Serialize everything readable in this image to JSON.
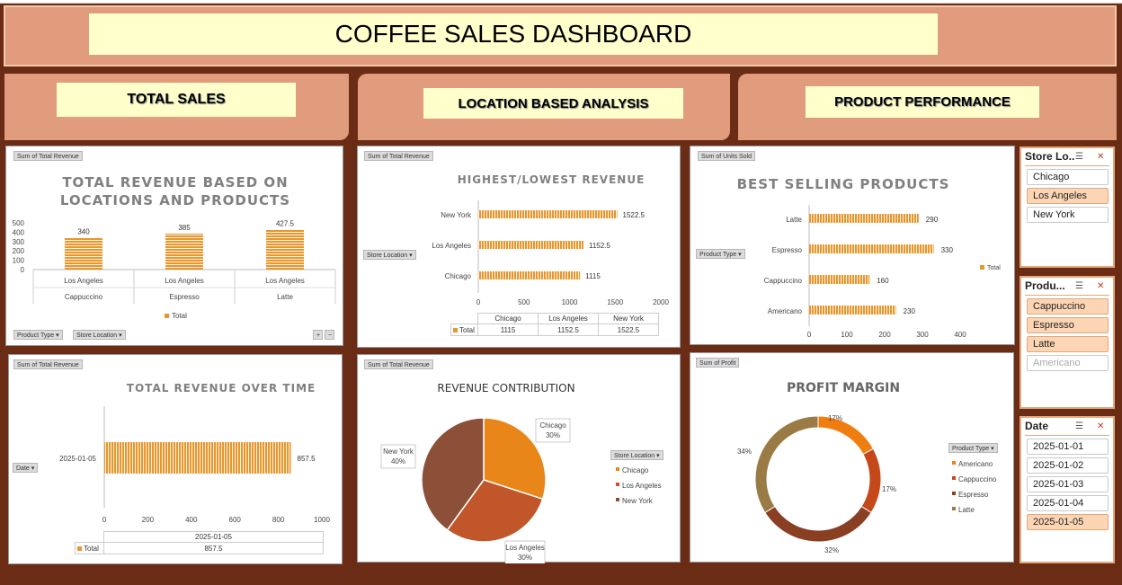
{
  "title": "COFFEE SALES DASHBOARD",
  "sections": {
    "total_sales": "TOTAL SALES",
    "location": "LOCATION BASED ANALYSIS",
    "product": "PRODUCT PERFORMANCE"
  },
  "colors": {
    "bar": "#e8962e",
    "dark_brown": "#6a2c14",
    "salmon": "#e09c7c",
    "label_yellow": "#ffffcc",
    "slicer_selected": "#fcd5b4"
  },
  "chart1": {
    "field": "Sum of Total Revenue",
    "title_line1": "TOTAL REVENUE  BASED ON",
    "title_line2": "LOCATIONS AND PRODUCTS",
    "filter1": "Product Type",
    "filter2": "Store Location",
    "legend": "Total",
    "yticks": [
      "500",
      "400",
      "300",
      "200",
      "100",
      "0"
    ]
  },
  "chart2": {
    "field": "Sum of Total Revenue",
    "title": "HIGHEST/LOWEST REVENUE",
    "filter": "Store Location",
    "xticks": [
      "0",
      "500",
      "1000",
      "1500",
      "2000"
    ],
    "table_total": "Total"
  },
  "chart3": {
    "field": "Sum of Units Sold",
    "title": "BEST SELLING PRODUCTS",
    "filter": "Product Type",
    "xticks": [
      "0",
      "100",
      "200",
      "300",
      "400"
    ],
    "legend": "Total"
  },
  "chart4": {
    "field": "Sum of Total Revenue",
    "title": "TOTAL REVENUE OVER TIME",
    "filter": "Date",
    "xticks": [
      "0",
      "200",
      "400",
      "600",
      "800",
      "1000"
    ],
    "table_total": "Total"
  },
  "chart5": {
    "field": "Sum of Total Revenue",
    "title": "REVENUE CONTRIBUTION",
    "filter": "Store Location"
  },
  "chart6": {
    "field": "Sum of Profit",
    "title": "PROFIT MARGIN",
    "filter": "Product Type"
  },
  "chart_data": [
    {
      "type": "bar",
      "title": "TOTAL REVENUE  BASED ON LOCATIONS AND PRODUCTS",
      "categories": [
        "Los Angeles / Cappuccino",
        "Los Angeles / Espresso",
        "Los Angeles / Latte"
      ],
      "outer": [
        "Cappuccino",
        "Espresso",
        "Latte"
      ],
      "inner": [
        "Los Angeles",
        "Los Angeles",
        "Los Angeles"
      ],
      "series": [
        {
          "name": "Total",
          "values": [
            340,
            385,
            427.5
          ]
        }
      ],
      "ylim": [
        0,
        500
      ]
    },
    {
      "type": "bar",
      "orientation": "horizontal",
      "title": "HIGHEST/LOWEST REVENUE",
      "categories": [
        "New York",
        "Los Angeles",
        "Chicago"
      ],
      "series": [
        {
          "name": "Total",
          "values": [
            1522.5,
            1152.5,
            1115
          ]
        }
      ],
      "xlim": [
        0,
        2000
      ],
      "table": {
        "columns": [
          "Chicago",
          "Los Angeles",
          "New York"
        ],
        "values": [
          "1115",
          "1152.5",
          "1522.5"
        ]
      }
    },
    {
      "type": "bar",
      "orientation": "horizontal",
      "title": "BEST SELLING PRODUCTS",
      "categories": [
        "Latte",
        "Espresso",
        "Cappuccino",
        "Americano"
      ],
      "series": [
        {
          "name": "Total",
          "values": [
            290,
            330,
            160,
            230
          ]
        }
      ],
      "xlim": [
        0,
        400
      ]
    },
    {
      "type": "bar",
      "orientation": "horizontal",
      "title": "TOTAL REVENUE OVER TIME",
      "categories": [
        "2025-01-05"
      ],
      "series": [
        {
          "name": "Total",
          "values": [
            857.5
          ]
        }
      ],
      "xlim": [
        0,
        1000
      ],
      "table": {
        "columns": [
          "2025-01-05"
        ],
        "values": [
          "857.5"
        ]
      }
    },
    {
      "type": "pie",
      "title": "REVENUE CONTRIBUTION",
      "categories": [
        "Chicago",
        "Los Angeles",
        "New York"
      ],
      "values": [
        30,
        30,
        40
      ],
      "labels": [
        "30%",
        "30%",
        "40%"
      ],
      "colors": [
        "#e8861a",
        "#c0562a",
        "#8b5037"
      ]
    },
    {
      "type": "pie",
      "donut": true,
      "title": "PROFIT MARGIN",
      "categories": [
        "Americano",
        "Cappuccino",
        "Espresso",
        "Latte"
      ],
      "values": [
        17,
        17,
        32,
        34
      ],
      "labels": [
        "17%",
        "17%",
        "32%",
        "34%"
      ],
      "colors": [
        "#f07d10",
        "#c4481a",
        "#8a3e22",
        "#9a7b45"
      ]
    }
  ],
  "slicers": [
    {
      "name": "Store Lo...",
      "items": [
        {
          "label": "Chicago",
          "state": "normal"
        },
        {
          "label": "Los Angeles",
          "state": "sel"
        },
        {
          "label": "New York",
          "state": "normal"
        }
      ]
    },
    {
      "name": "Produ...",
      "items": [
        {
          "label": "Cappuccino",
          "state": "sel"
        },
        {
          "label": "Espresso",
          "state": "sel"
        },
        {
          "label": "Latte",
          "state": "sel"
        },
        {
          "label": "Americano",
          "state": "dim"
        }
      ]
    },
    {
      "name": "Date",
      "items": [
        {
          "label": "2025-01-01",
          "state": "normal"
        },
        {
          "label": "2025-01-02",
          "state": "normal"
        },
        {
          "label": "2025-01-03",
          "state": "normal"
        },
        {
          "label": "2025-01-04",
          "state": "normal"
        },
        {
          "label": "2025-01-05",
          "state": "sel"
        }
      ]
    }
  ]
}
